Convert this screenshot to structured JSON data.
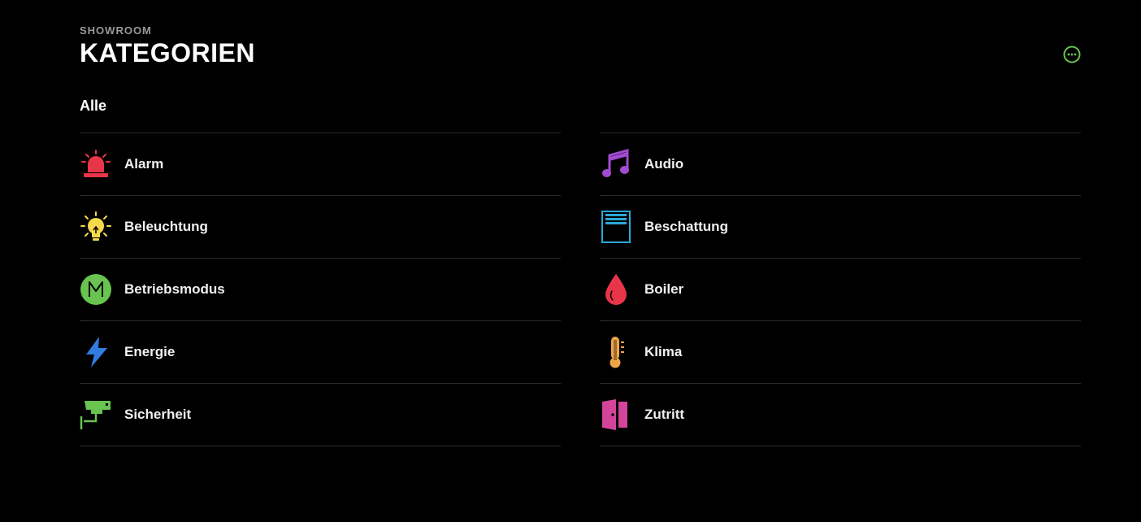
{
  "header": {
    "overline": "SHOWROOM",
    "title": "KATEGORIEN",
    "more_icon": "more-circle-icon",
    "accent": "#69c350"
  },
  "section": {
    "label": "Alle"
  },
  "categories": {
    "left": [
      {
        "label": "Alarm",
        "icon": "alarm-siren-icon",
        "color": "#e8354a"
      },
      {
        "label": "Beleuchtung",
        "icon": "lightbulb-icon",
        "color": "#f5d94a"
      },
      {
        "label": "Betriebsmodus",
        "icon": "mode-m-icon",
        "color": "#69c350"
      },
      {
        "label": "Energie",
        "icon": "lightning-icon",
        "color": "#2f7de1"
      },
      {
        "label": "Sicherheit",
        "icon": "security-camera-icon",
        "color": "#69c350"
      }
    ],
    "right": [
      {
        "label": "Audio",
        "icon": "music-note-icon",
        "color": "#a24bd1"
      },
      {
        "label": "Beschattung",
        "icon": "blinds-icon",
        "color": "#2aa8d6"
      },
      {
        "label": "Boiler",
        "icon": "water-drop-icon",
        "color": "#e8354a"
      },
      {
        "label": "Klima",
        "icon": "thermometer-icon",
        "color": "#f0a54a"
      },
      {
        "label": "Zutritt",
        "icon": "door-icon",
        "color": "#d3449b"
      }
    ]
  }
}
